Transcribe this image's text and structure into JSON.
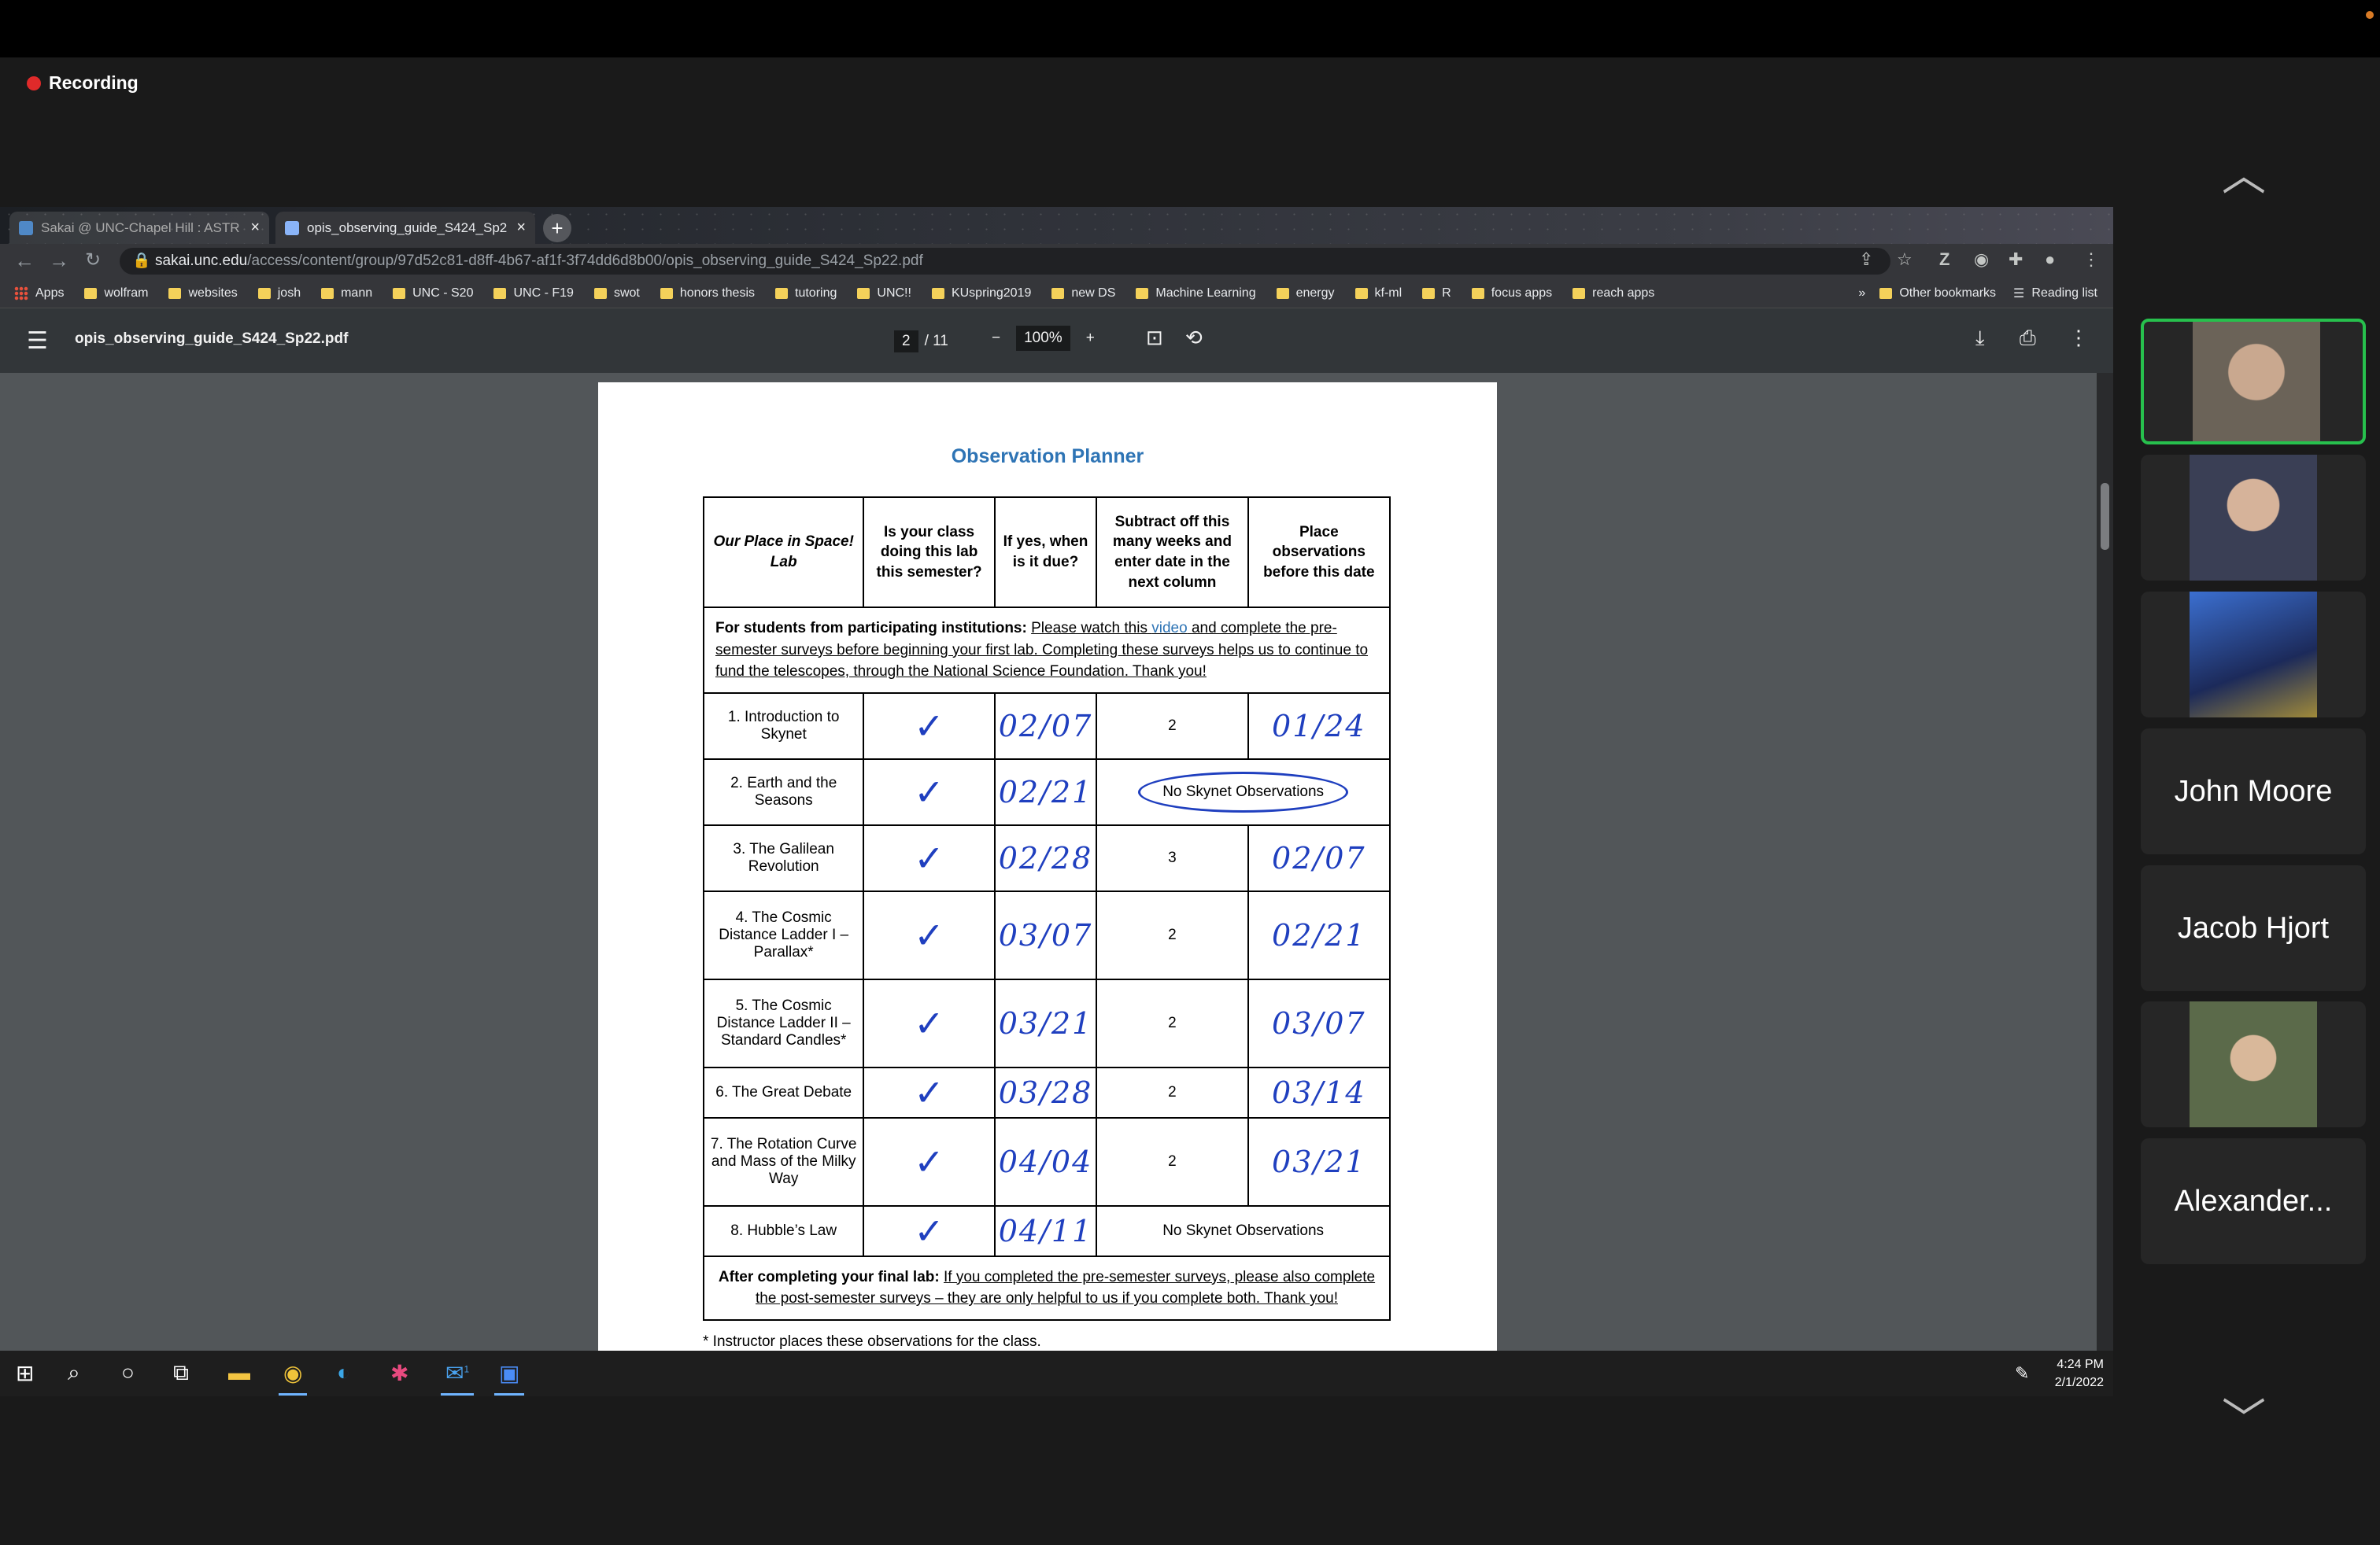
{
  "recording": {
    "label": "Recording"
  },
  "browser": {
    "tabs": [
      {
        "title": "Sakai @ UNC-Chapel Hill : ASTR",
        "active": false
      },
      {
        "title": "opis_observing_guide_S424_Sp2",
        "active": true
      }
    ],
    "address": {
      "host": "sakai.unc.edu",
      "path": "/access/content/group/97d52c81-d8ff-4b67-af1f-3f74dd6d8b00/opis_observing_guide_S424_Sp22.pdf"
    },
    "bookmarks": [
      "Apps",
      "wolfram",
      "websites",
      "josh",
      "mann",
      "UNC - S20",
      "UNC - F19",
      "swot",
      "honors thesis",
      "tutoring",
      "UNC!!",
      "KUspring2019",
      "new DS",
      "Machine Learning",
      "energy",
      "kf-ml",
      "R",
      "focus apps",
      "reach apps"
    ],
    "bookmarks_overflow": "»",
    "other_bookmarks": "Other bookmarks",
    "reading_list": "Reading list"
  },
  "pdf": {
    "filename": "opis_observing_guide_S424_Sp22.pdf",
    "page_current": "2",
    "page_total": "/ 11",
    "zoom": "100%",
    "title": "Observation Planner",
    "headers": [
      "Our Place in Space! Lab",
      "Is your class doing this lab this semester?",
      "If yes, when is it due?",
      "Subtract off this many weeks and enter date in the next column",
      "Place observations before this date"
    ],
    "intro_note": {
      "bold": "For students from participating institutions:",
      "pre": "Please watch this",
      "link": "video",
      "post": "and complete the pre-semester surveys before beginning your first lab.  Completing these surveys helps us to continue to fund the telescopes, through the National Science Foundation.  Thank you!"
    },
    "rows": [
      {
        "lab": "1. Introduction to Skynet",
        "check": "✓",
        "due": "02/07",
        "weeks": "2",
        "place": "01/24"
      },
      {
        "lab": "2. Earth and the Seasons",
        "check": "✓",
        "due": "02/21",
        "merged": "No Skynet Observations"
      },
      {
        "lab": "3. The Galilean Revolution",
        "check": "✓",
        "due": "02/28",
        "weeks": "3",
        "place": "02/07"
      },
      {
        "lab": "4. The Cosmic Distance Ladder I – Parallax*",
        "check": "✓",
        "due": "03/07",
        "weeks": "2",
        "place": "02/21"
      },
      {
        "lab": "5. The Cosmic Distance Ladder II – Standard Candles*",
        "check": "✓",
        "due": "03/21",
        "weeks": "2",
        "place": "03/07"
      },
      {
        "lab": "6. The Great Debate",
        "check": "✓",
        "due": "03/28",
        "weeks": "2",
        "place": "03/14"
      },
      {
        "lab": "7. The Rotation Curve and Mass of the Milky Way",
        "check": "✓",
        "due": "04/04",
        "weeks": "2",
        "place": "03/21"
      },
      {
        "lab": "8. Hubble’s Law",
        "check": "✓",
        "due": "04/11",
        "merged": "No Skynet Observations"
      }
    ],
    "outro_note": {
      "bold": "After completing your final lab:",
      "text": "If you completed the pre-semester surveys, please also complete the post-semester surveys – they are only helpful to us if you complete both.  Thank you!"
    },
    "footnote": "* Instructor places these observations for the class."
  },
  "taskbar": {
    "time": "4:24 PM",
    "date": "2/1/2022",
    "mail_badge": "1"
  },
  "participants": [
    {
      "name": "",
      "video": true,
      "active": true,
      "bg": "#6b6358"
    },
    {
      "name": "",
      "video": true,
      "active": false,
      "bg": "#3a3f55"
    },
    {
      "name": "",
      "video": true,
      "active": false,
      "bg": "#2d4e9a"
    },
    {
      "name": "John Moore",
      "video": false
    },
    {
      "name": "Jacob Hjort",
      "video": false
    },
    {
      "name": "",
      "video": true,
      "active": false,
      "bg": "#5b6a4a"
    },
    {
      "name": "Alexander...",
      "video": false
    }
  ],
  "colors": {
    "ink": "#1f3fbf",
    "title_blue": "#2e74b5",
    "active_speaker": "#27c04d",
    "record_dot": "#e02a2a"
  }
}
